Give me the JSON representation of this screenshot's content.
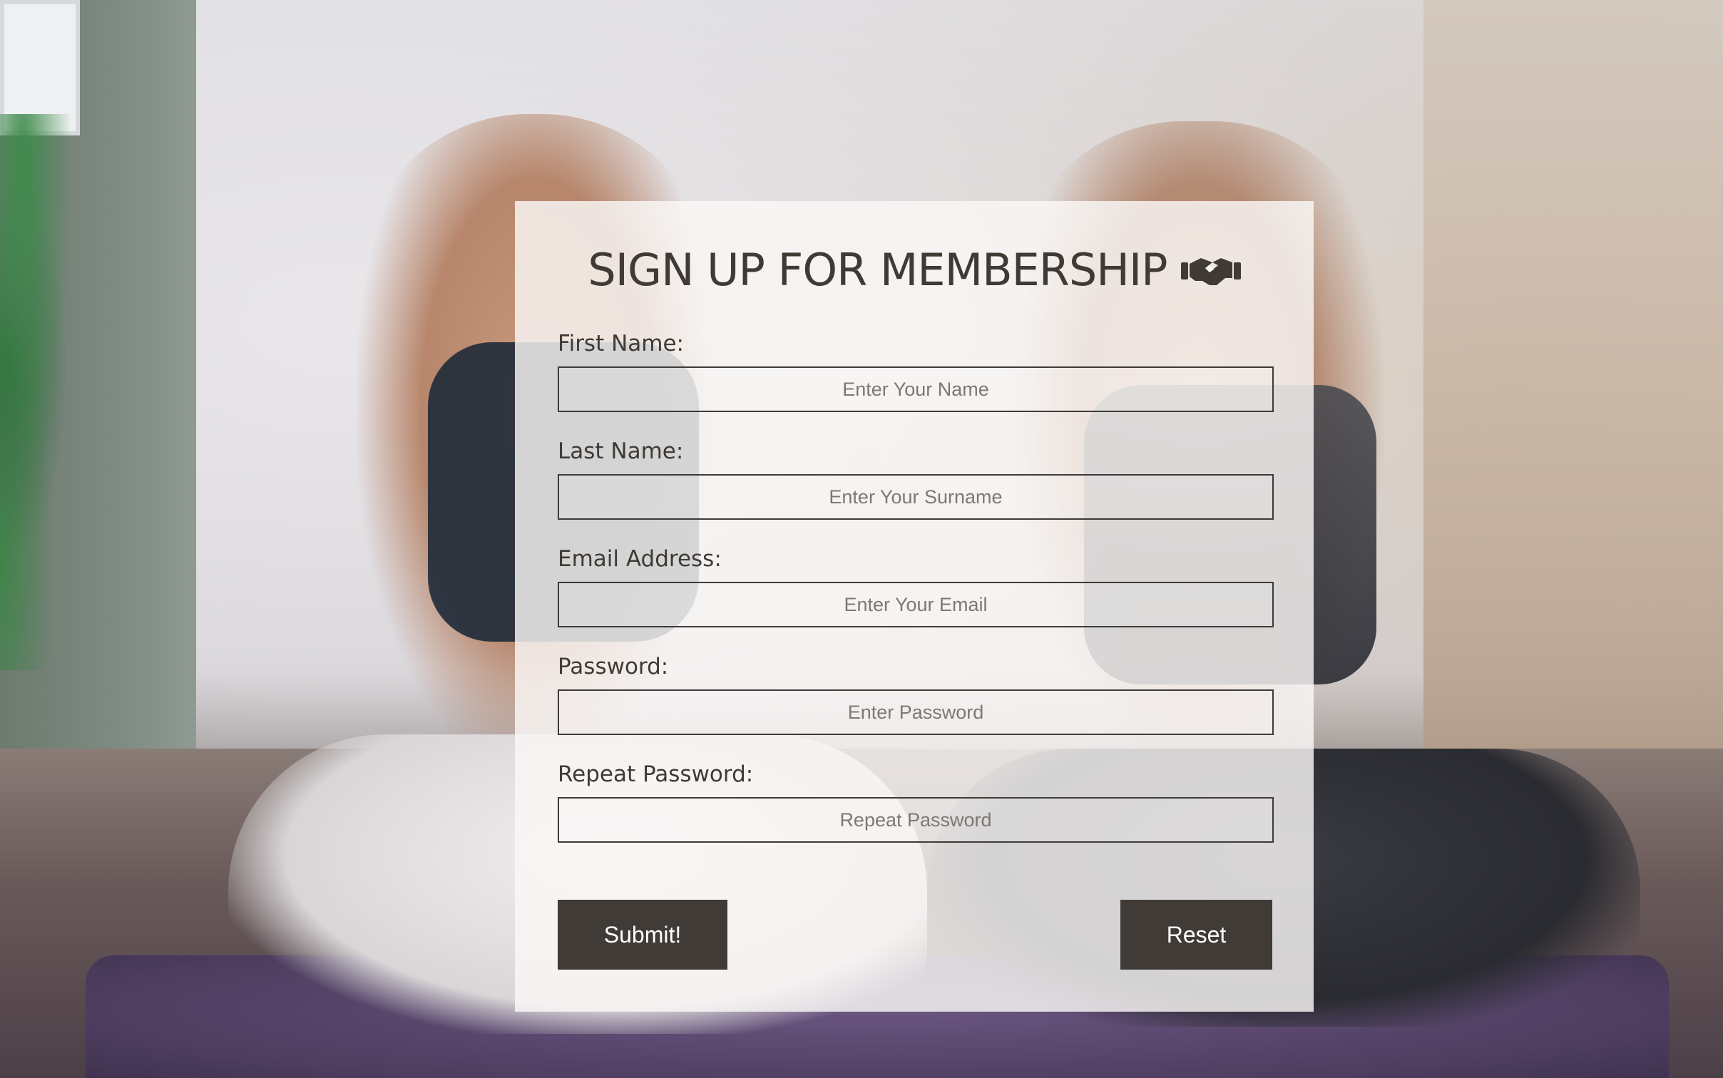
{
  "form": {
    "title": "SIGN UP FOR MEMBERSHIP",
    "title_icon": "handshake-icon",
    "fields": [
      {
        "label": "First Name:",
        "placeholder": "Enter Your Name",
        "value": ""
      },
      {
        "label": "Last Name:",
        "placeholder": "Enter Your Surname",
        "value": ""
      },
      {
        "label": "Email Address:",
        "placeholder": "Enter Your Email",
        "value": ""
      },
      {
        "label": "Password:",
        "placeholder": "Enter Password",
        "value": ""
      },
      {
        "label": "Repeat Password:",
        "placeholder": "Repeat Password",
        "value": ""
      }
    ],
    "submit_label": "Submit!",
    "reset_label": "Reset"
  },
  "colors": {
    "text": "#3f3a34",
    "button_bg": "#403b36",
    "button_text": "#ffffff",
    "panel_bg": "rgba(250,248,246,0.82)",
    "input_border": "#3d3a37"
  }
}
